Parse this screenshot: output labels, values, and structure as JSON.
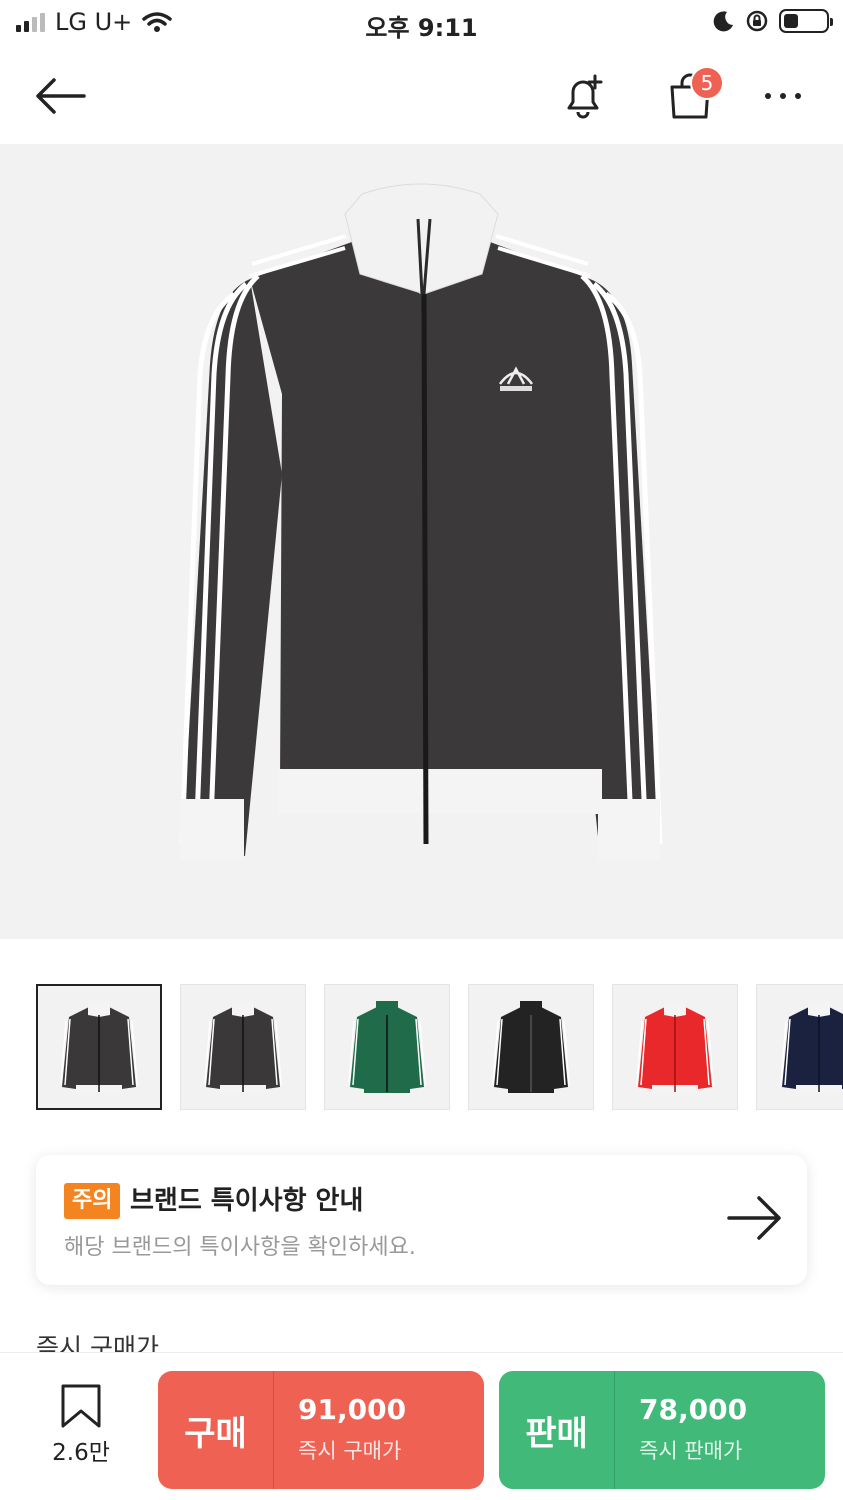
{
  "status_bar": {
    "carrier": "LG U+",
    "time": "오후 9:11",
    "icons": [
      "signal-icon",
      "wifi-icon",
      "moon-icon",
      "rotation-lock-icon",
      "battery-icon"
    ]
  },
  "top_nav": {
    "icons": [
      "back-arrow-icon",
      "bell-plus-icon",
      "shopping-bag-icon",
      "more-dots-icon"
    ],
    "cart_badge": "5"
  },
  "product_images": {
    "thumbnails": [
      {
        "color": "#3a3838",
        "collar": "#f4f4f4",
        "stripes": "#ffffff",
        "selected": true
      },
      {
        "color": "#3a3838",
        "collar": "#f4f4f4",
        "stripes": "#ffffff",
        "selected": false
      },
      {
        "color": "#1f6b4a",
        "collar": "#1f6b4a",
        "stripes": "#ffffff",
        "selected": false
      },
      {
        "color": "#232323",
        "collar": "#232323",
        "stripes": "#ffffff",
        "selected": false
      },
      {
        "color": "#e8282b",
        "collar": "#f4f4f4",
        "stripes": "#ffffff",
        "selected": false
      },
      {
        "color": "#1b2240",
        "collar": "#f4f4f4",
        "stripes": "#ffffff",
        "selected": false
      }
    ]
  },
  "notice": {
    "tag": "주의",
    "title": "브랜드 특이사항 안내",
    "subtitle": "해당 브랜드의 특이사항을 확인하세요."
  },
  "section_peek": "즉시 구매가",
  "bottom_bar": {
    "wish_count": "2.6만",
    "buy": {
      "label": "구매",
      "price": "91,000",
      "sub": "즉시 구매가"
    },
    "sell": {
      "label": "판매",
      "price": "78,000",
      "sub": "즉시 판매가"
    }
  },
  "colors": {
    "buy": "#ef6253",
    "sell": "#41b979",
    "notice_tag": "#f4841f",
    "badge": "#ef6253"
  }
}
